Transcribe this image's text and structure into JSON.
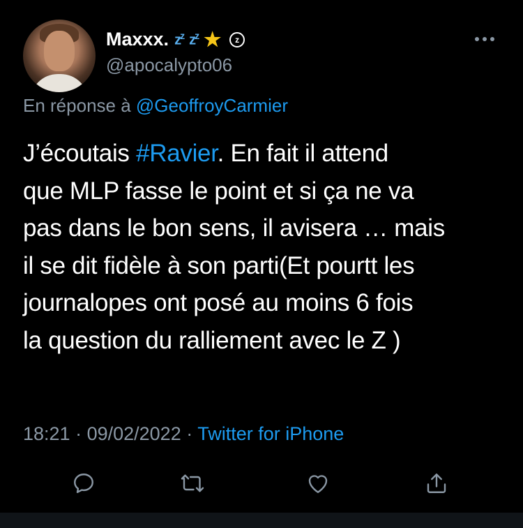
{
  "user": {
    "display_name": "Maxxx.",
    "zz_1": "z",
    "zz_2": "z",
    "zz_3": "z",
    "zz_4": "z",
    "handle": "@apocalypto06"
  },
  "reply": {
    "prefix": "En réponse à",
    "mention": "@GeoffroyCarmier"
  },
  "tweet": {
    "line1_a": "J’écoutais ",
    "line1_hashtag": "#Ravier",
    "line1_b": ". En fait il attend",
    "line2": "que MLP fasse le point et si ça ne va",
    "line3": "pas dans le bon sens, il avisera … mais",
    "line4": "il se dit fidèle à son parti(Et pourtt les",
    "line5": "journalopes ont posé au moins 6 fois",
    "line6": "la question du ralliement avec le Z )"
  },
  "meta": {
    "time": "18:21",
    "separator": " · ",
    "date": "09/02/2022",
    "separator2": " · ",
    "source": "Twitter for iPhone"
  },
  "icons": {
    "reply": "reply-icon",
    "retweet": "retweet-icon",
    "like": "heart-icon",
    "share": "share-icon",
    "more": "more-icon",
    "badge": "circle-badge-icon",
    "star": "star-icon"
  },
  "colors": {
    "background": "#000000",
    "link": "#1d9bf0",
    "secondary": "#8b98a5",
    "star": "#f5c518"
  }
}
